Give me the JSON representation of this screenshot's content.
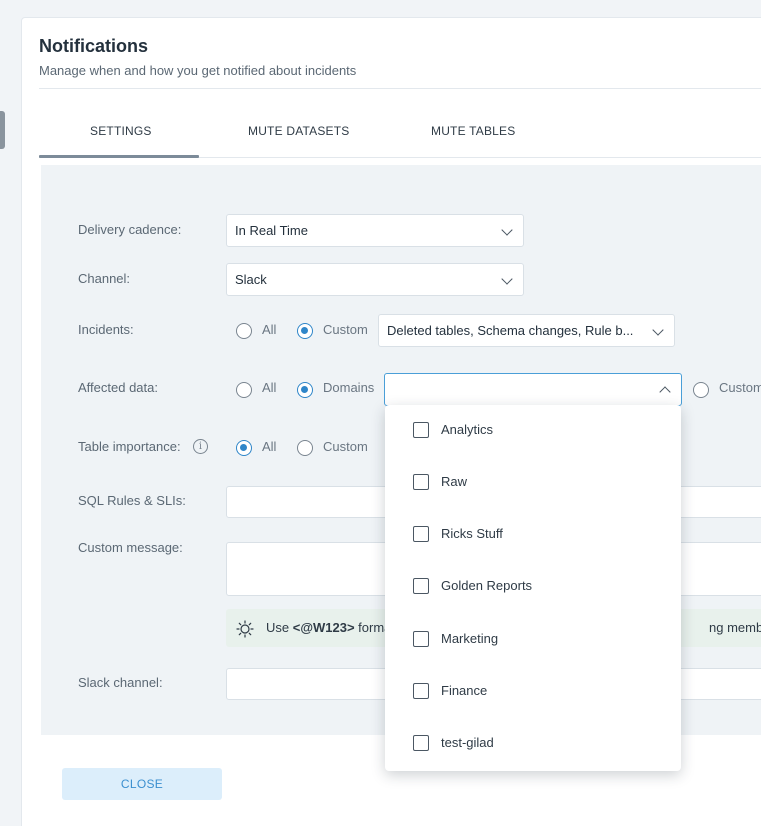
{
  "header": {
    "title": "Notifications",
    "subtitle": "Manage when and how you get notified about incidents"
  },
  "tabs": [
    {
      "label": "SETTINGS",
      "active": true
    },
    {
      "label": "MUTE DATASETS",
      "active": false
    },
    {
      "label": "MUTE TABLES",
      "active": false
    }
  ],
  "form": {
    "delivery_cadence": {
      "label": "Delivery cadence:",
      "value": "In Real Time"
    },
    "channel": {
      "label": "Channel:",
      "value": "Slack"
    },
    "incidents": {
      "label": "Incidents:",
      "options": [
        "All",
        "Custom"
      ],
      "selected": "Custom",
      "value": "Deleted tables, Schema changes, Rule b..."
    },
    "affected_data": {
      "label": "Affected data:",
      "options": [
        "All",
        "Domains",
        "Custom"
      ],
      "selected": "Domains",
      "value": ""
    },
    "table_importance": {
      "label": "Table importance:",
      "options": [
        "All",
        "Custom"
      ],
      "selected": "All"
    },
    "sql_rules": {
      "label": "SQL Rules & SLIs:",
      "value": ""
    },
    "custom_message": {
      "label": "Custom message:",
      "value": ""
    },
    "hint": {
      "prefix": "Use ",
      "code": "<@W123>",
      "middle": " forma",
      "suffix": "ng member ID"
    },
    "slack_channel": {
      "label": "Slack channel:",
      "value": ""
    }
  },
  "domains_dropdown": {
    "options": [
      "Analytics",
      "Raw",
      "Ricks Stuff",
      "Golden Reports",
      "Marketing",
      "Finance",
      "test-gilad"
    ]
  },
  "footer": {
    "close_label": "CLOSE"
  },
  "colors": {
    "accent": "#2f86c9",
    "close_bg": "#dceefb"
  }
}
